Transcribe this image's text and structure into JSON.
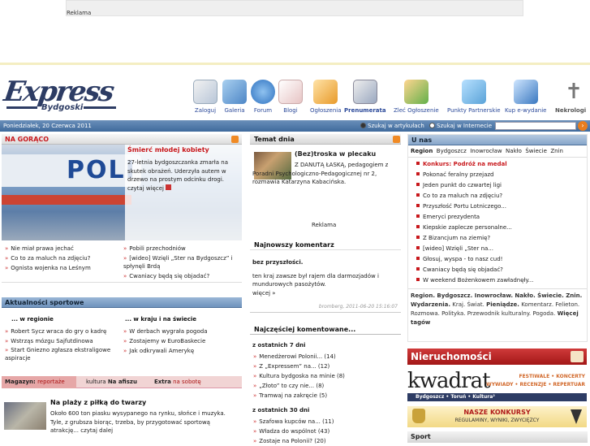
{
  "ad_top": {
    "label": "Reklama"
  },
  "logo": {
    "brand": "Express",
    "city": "Bydgoski"
  },
  "nav": [
    {
      "label": "Zaloguj",
      "icon": "login-icon"
    },
    {
      "label": "Galeria",
      "icon": "gallery-icon"
    },
    {
      "label": "Forum",
      "icon": "forum-icon"
    },
    {
      "label": "Blogi",
      "icon": "blog-icon"
    },
    {
      "label": "Ogłoszenia",
      "icon": "ads-icon"
    },
    {
      "label": "Prenumerata",
      "icon": "subscription-icon"
    },
    {
      "label": "Zleć Ogłoszenie",
      "icon": "order-ad-icon"
    },
    {
      "label": "Punkty Partnerskie",
      "icon": "partner-icon"
    },
    {
      "label": "Kup e-wydanie",
      "icon": "eedition-icon"
    },
    {
      "label": "Nekrologi",
      "icon": "cross-icon"
    }
  ],
  "datebar": {
    "date": "Poniedziałek, 20 Czerwca 2011",
    "opt1": "Szukaj w artykułach",
    "opt2": "Szukaj w Internecie",
    "go": "›"
  },
  "hot": {
    "title": "NA GORĄCO",
    "image_text": "POLI",
    "headline": "Śmierć młodej kobiety",
    "text": "27-letnia bydgoszczanka zmarła na skutek obrażeń. Uderzyła autem w drzewo na prostym odcinku drogi.",
    "more": "czytaj więcej",
    "links_left": [
      "Nie miał prawa jechać",
      "Co to za maluch na zdjęciu?",
      "Ognista wojenka na Leśnym"
    ],
    "links_right": [
      "Pobili przechodniów",
      "[wideo] Wzięli „Ster na Bydgoszcz” i spłynęli Brdą",
      "Cwaniacy będą się objadać?"
    ]
  },
  "sport": {
    "title": "Aktualności sportowe",
    "col1_head": "... w regionie",
    "col2_head": "... w kraju i na świecie",
    "col1": [
      "Robert Sycz wraca do gry o kadrę",
      "Wstrząs mózgu Sajfutdinowa",
      "Start Gniezno zgłasza ekstraligowe aspiracje"
    ],
    "col2": [
      "W derbach wygrała pogoda",
      "Zostajemy w EuroBaskecie",
      "Jak odkrywali Amerykę"
    ]
  },
  "magazine": {
    "tab1_bold": "Magazyn:",
    "tab1": "reportaże",
    "tab2": "kultura",
    "tab2_bold": "Na afiszu",
    "tab3_bold": "Extra",
    "tab3": "na sobotę",
    "headline": "Na plaży z piłką do twarzy",
    "text": "Około 600 ton piasku wysypanego na rynku, słońce i muzyka. Tyle, z grubsza biorąc, trzeba, by przygotować sportową atrakcję...",
    "more": "czytaj dalej"
  },
  "topic": {
    "title": "Temat dnia",
    "headline": "(Bez)troska w plecaku",
    "text": "Z DANUTĄ ŁASKĄ, pedagogiem z Poradni Psychologiczno-Pedagogicznej nr 2, rozmawia Katarzyna Kabacińska."
  },
  "mid_ad": {
    "label": "Reklama"
  },
  "comment": {
    "title": "Najnowszy komentarz",
    "heading": "bez przyszłości.",
    "text": "ten kraj zawsze był rajem dla darmozjadów i mundurowych pasożytów.",
    "more": "więcej »",
    "author": "bromberg, 2011-06-20 15:16:07"
  },
  "most": {
    "title": "Najczęściej komentowane...",
    "p1": "z ostatnich 7 dni",
    "list1": [
      "Menedżerowi Polonii... (14)",
      "Z „Expressem” na... (12)",
      "Kultura bydgoska na minie (8)",
      "„Złoto” to czy nie... (8)",
      "Tramwaj na zakręcie (5)"
    ],
    "p2": "z ostatnich 30 dni",
    "list2": [
      "Szafowa kupców na... (11)",
      "Władza do wspólnot (43)",
      "Zostaje na Polonii? (20)"
    ]
  },
  "unas": {
    "title": "U nas",
    "tabs": [
      "Region",
      "Bydgoszcz",
      "Inowrocław",
      "Nakło",
      "Świecie",
      "Znin"
    ],
    "items": [
      {
        "text": "Konkurs: Podróż na medal",
        "bold": true
      },
      {
        "text": "Pokonać feralny przejazd"
      },
      {
        "text": "Jeden punkt do czwartej ligi"
      },
      {
        "text": "Co to za maluch na zdjęciu?"
      },
      {
        "text": "Przyszłość Portu Lotniczego..."
      },
      {
        "text": "Emeryci prezydenta"
      },
      {
        "text": "Kiepskie zaplecze personalne..."
      },
      {
        "text": "Z Bizancjum na ziemię?"
      },
      {
        "text": "[wideo] Wzięli „Ster na..."
      },
      {
        "text": "Głosuj, wyspa - to nasz cud!"
      },
      {
        "text": "Cwaniacy będą się objadać?"
      },
      {
        "text": "W weekend Bożenkowem zawładnęły..."
      }
    ],
    "tags_line1": "Region. Bydgoszcz. Inowrocław. Nakło. Świecie. Znin.",
    "tags_line2_bold": "Wydarzenia.",
    "tags_line2": "Kraj. Świat.",
    "tags_line2_b2": "Pieniądze.",
    "tags_line2_end": "Komentarz. Felieton.",
    "tags_line3": "Rozmowa. Polityka. Przewodnik kulturalny. Pogoda.",
    "tags_line3_bold": "Więcej",
    "tags_line4_bold": "tagów"
  },
  "nieruch": {
    "title": "Nieruchomości"
  },
  "kwadrat": {
    "name": "kwadrat",
    "tag1": "FESTIWALE • KONCERTY",
    "tag2": "WYWIADY • RECENZJE • REPERTUAR",
    "foot": "Bydgoszcz • Toruń • Kultura²"
  },
  "konkursy": {
    "title": "NASZE KONKURSY",
    "sub": "REGULAMINY, WYNIKI, ZWYCIĘZCY"
  },
  "sport_box": {
    "title": "Sport"
  },
  "colors": {
    "brand": "#2d3c64",
    "accent": "#c8181c",
    "bar": "#4f78a8"
  }
}
